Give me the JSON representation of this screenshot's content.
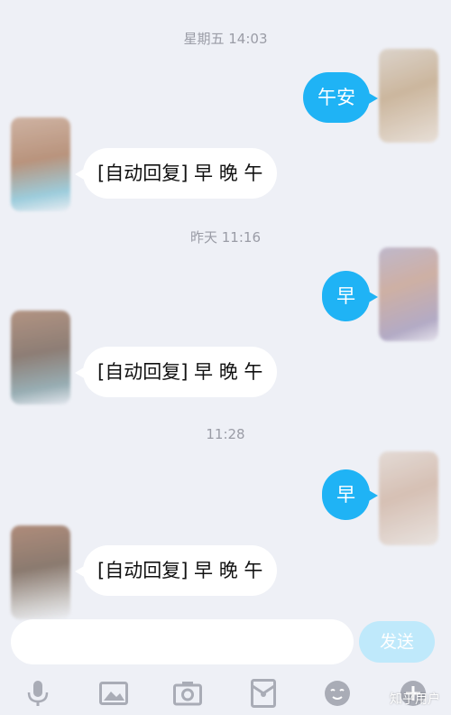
{
  "timestamps": [
    "星期五 14:03",
    "昨天 11:16",
    "11:28"
  ],
  "outgoing": [
    "午安",
    "早",
    "早"
  ],
  "incoming": [
    "[自动回复] 早  晚   午",
    "[自动回复] 早  晚   午",
    "[自动回复] 早  晚   午"
  ],
  "composer": {
    "send_label": "发送",
    "placeholder": ""
  },
  "toolbar": {
    "icons": [
      "microphone-icon",
      "image-icon",
      "camera-icon",
      "red-envelope-icon",
      "emoji-icon",
      "plus-icon"
    ]
  },
  "watermark": "知乎用户",
  "colors": {
    "accent": "#1fb3f5",
    "background": "#eef0f6",
    "send_disabled": "#bfe9fb"
  }
}
